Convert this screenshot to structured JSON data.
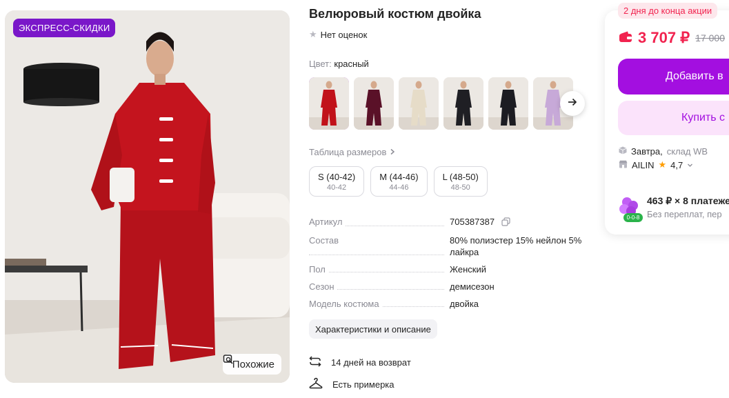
{
  "gallery": {
    "badge": "ЭКСПРЕСС-СКИДКИ",
    "similar_label": "Похожие"
  },
  "product": {
    "title": "Велюровый костюм двойка",
    "rating_text": "Нет оценок",
    "color_label": "Цвет:",
    "color_value": "красный",
    "swatch_colors": [
      "#c1121a",
      "#5a1128",
      "#e6dcc8",
      "#1f1f24",
      "#1c1c22",
      "#c7a9d8"
    ],
    "size_table_label": "Таблица размеров",
    "sizes": [
      {
        "main": "S (40-42)",
        "sub": "40-42"
      },
      {
        "main": "M (44-46)",
        "sub": "44-46"
      },
      {
        "main": "L (48-50)",
        "sub": "48-50"
      }
    ],
    "specs": [
      {
        "key": "Артикул",
        "value": "705387387"
      },
      {
        "key": "Состав",
        "value": "80% полиэстер 15% нейлон 5% лайкра"
      },
      {
        "key": "Пол",
        "value": "Женский"
      },
      {
        "key": "Сезон",
        "value": "демисезон"
      },
      {
        "key": "Модель костюма",
        "value": "двойка"
      }
    ],
    "chars_button": "Характеристики и описание",
    "features": [
      {
        "icon": "return-arrows-icon",
        "text": "14 дней на возврат"
      },
      {
        "icon": "hanger-icon",
        "text": "Есть примерка"
      }
    ]
  },
  "buy_card": {
    "promo": "2 дня до конца акции",
    "price": "3 707 ₽",
    "old_price": "17 000",
    "add_to_cart": "Добавить в",
    "buy_now": "Купить с",
    "delivery_day": "Завтра,",
    "delivery_from": "склад WB",
    "seller_name": "AILIN",
    "seller_rating": "4,7",
    "installment_badge": "0-0-8",
    "installment_main": "463 ₽ × 8 платеже",
    "installment_sub": "Без переплат, пер"
  },
  "colors": {
    "accent_purple": "#a30fe0",
    "price_red": "#f1234f",
    "badge_purple": "#7a17c9"
  }
}
